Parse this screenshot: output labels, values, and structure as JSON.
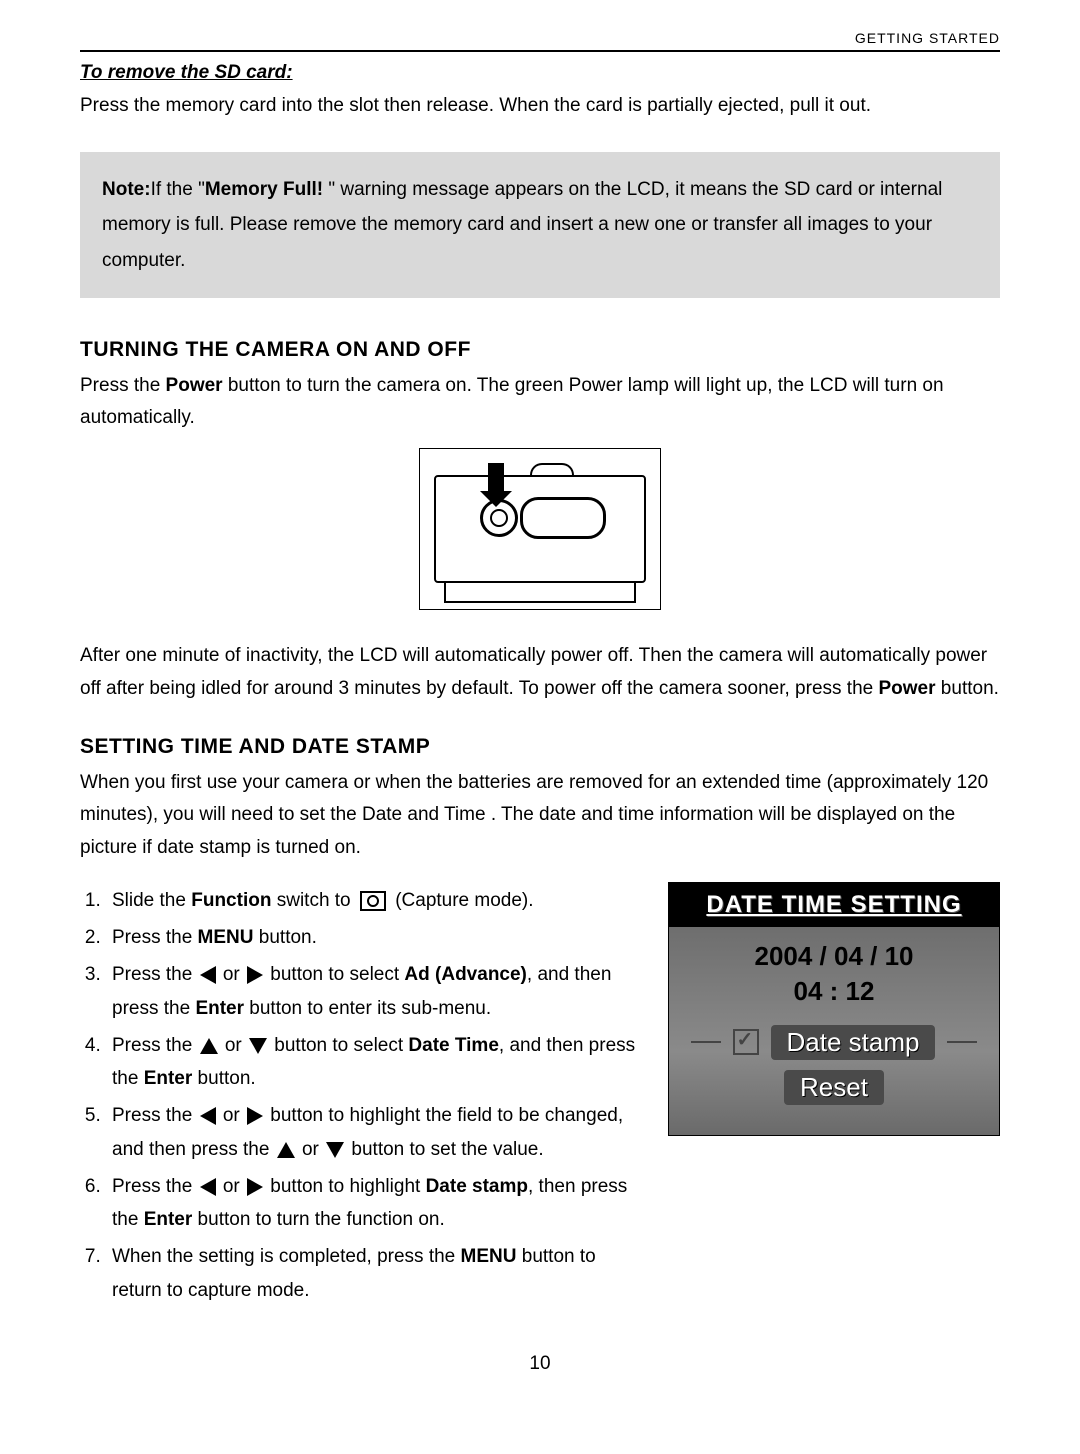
{
  "header": {
    "section": "GETTING STARTED"
  },
  "sd": {
    "subtitle": "To remove the SD card:",
    "text": "Press the memory card into the slot then release. When the card is partially ejected, pull it out."
  },
  "note": {
    "prefix": "Note:",
    "bold1": "Memory Full! ",
    "body": "If the \"",
    "after_bold": "\" warning message appears on the LCD, it means the SD card or internal memory is full. Please remove the memory card and insert a new one or transfer all images to your computer."
  },
  "power": {
    "heading": "TURNING THE CAMERA ON AND OFF",
    "p1a": "Press the ",
    "p1bold": "Power",
    "p1b": " button to turn the camera on. The green Power lamp will light up, the LCD will turn on automatically.",
    "p2a": "After one minute of  inactivity, the LCD will automatically power off. Then the camera will automatically power off after being idled for around 3 minutes by default. To power off the camera sooner, press the ",
    "p2bold": "Power",
    "p2b": " button."
  },
  "datetime": {
    "heading": "SETTING TIME AND DATE STAMP",
    "intro": "When you first use your camera or when the batteries are removed for an extended time (approximately 120 minutes), you will need to set the Date and Time . The date and time information will be displayed on the picture if date stamp is turned on.",
    "steps": {
      "s1a": "Slide the ",
      "s1bold": "Function",
      "s1b": " switch to ",
      "s1c": " (Capture mode).",
      "s2a": "Press the ",
      "s2bold": "MENU",
      "s2b": " button.",
      "s3a": "Press the ",
      "s3mid": " or ",
      "s3b": " button to select ",
      "s3bold": "Ad (Advance)",
      "s3c": ", and then press the ",
      "s3bold2": "Enter",
      "s3d": " button to enter its sub-menu.",
      "s4a": "Press the ",
      "s4mid": " or ",
      "s4b": " button to select ",
      "s4bold": "Date Time",
      "s4c": ", and then press the ",
      "s4bold2": "Enter",
      "s4d": " button.",
      "s5a": "Press the ",
      "s5mid": " or ",
      "s5b": " button to highlight the field to be changed, and then press the ",
      "s5mid2": " or ",
      "s5c": " button to set the value.",
      "s6a": "Press the ",
      "s6mid": " or ",
      "s6b": " button to highlight ",
      "s6bold": "Date stamp",
      "s6c": ", then press the ",
      "s6bold2": "Enter",
      "s6d": " button to turn the function on.",
      "s7a": "When the setting is completed, press the ",
      "s7bold": "MENU",
      "s7b": " button to return to capture mode."
    }
  },
  "lcd": {
    "title": "DATE TIME SETTING",
    "date": "2004 / 04 / 10",
    "time": "04 : 12",
    "btn1": "Date stamp",
    "btn2": "Reset"
  },
  "page_number": "10"
}
